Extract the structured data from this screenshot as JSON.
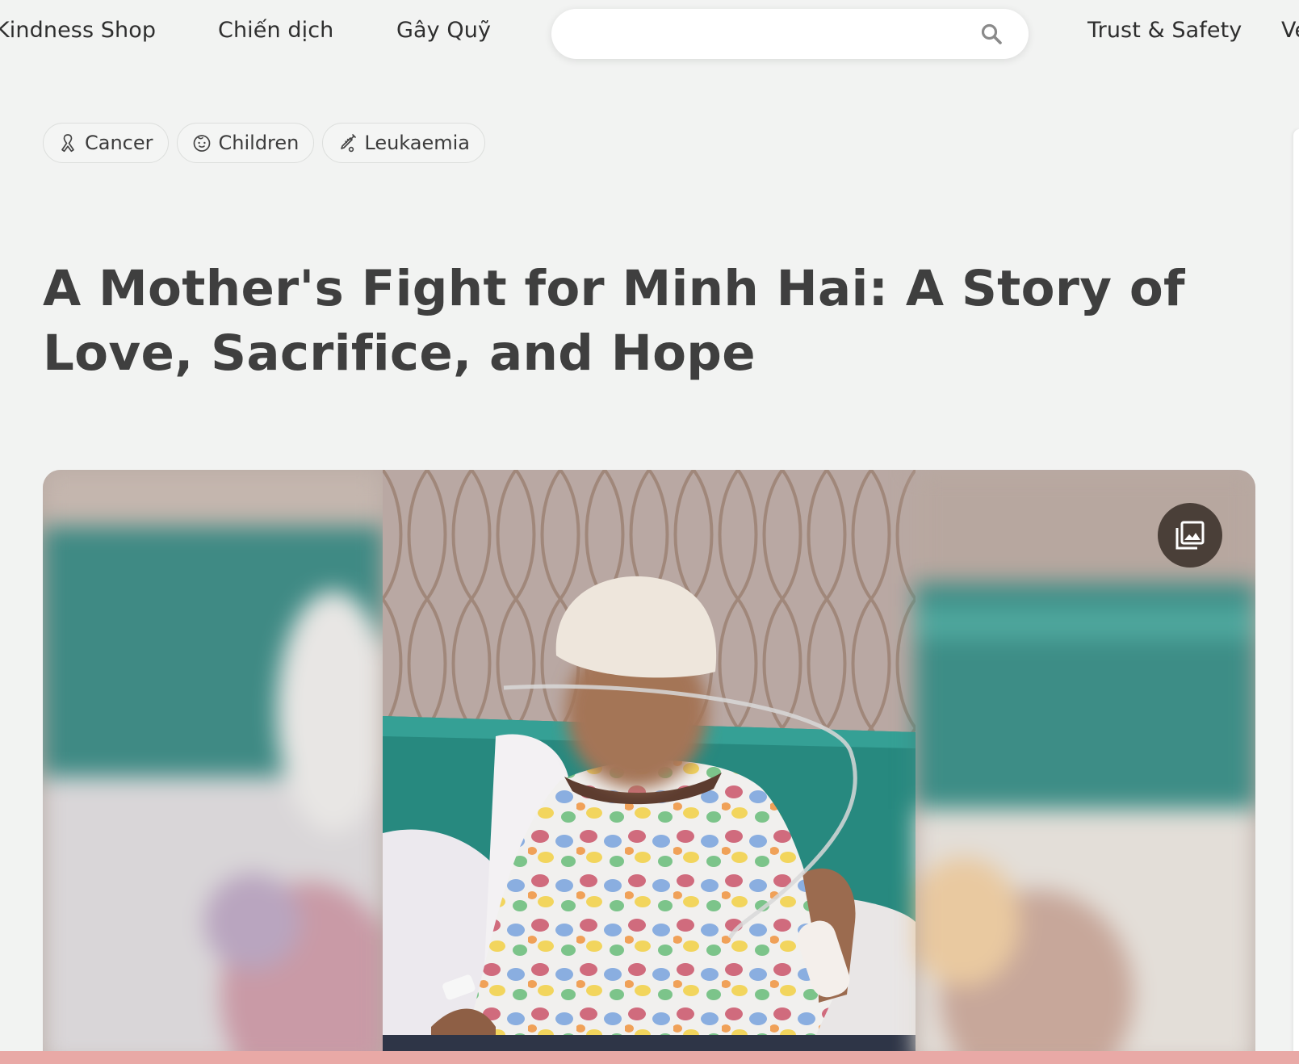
{
  "nav": {
    "kindness_shop": "Kindness Shop",
    "campaigns": "Chiến dịch",
    "fundraise": "Gây Quỹ",
    "trust_safety": "Trust & Safety",
    "partial_item": "Vé"
  },
  "search": {
    "value": "",
    "placeholder": "",
    "icon": "search-icon"
  },
  "tags": [
    {
      "label": "Cancer",
      "icon": "ribbon-icon"
    },
    {
      "label": "Children",
      "icon": "child-face-icon"
    },
    {
      "label": "Leukaemia",
      "icon": "syringe-icon"
    }
  ],
  "campaign": {
    "title": "A Mother's Fight for Minh Hai: A Story of Love, Sacrifice, and Hope"
  },
  "hero": {
    "gallery_icon": "gallery-icon"
  },
  "colors": {
    "background": "#f2f3f2",
    "gallery_button": "#4a3f38",
    "bottom_bar": "#e9a9a6",
    "text": "#3f3f3f"
  }
}
